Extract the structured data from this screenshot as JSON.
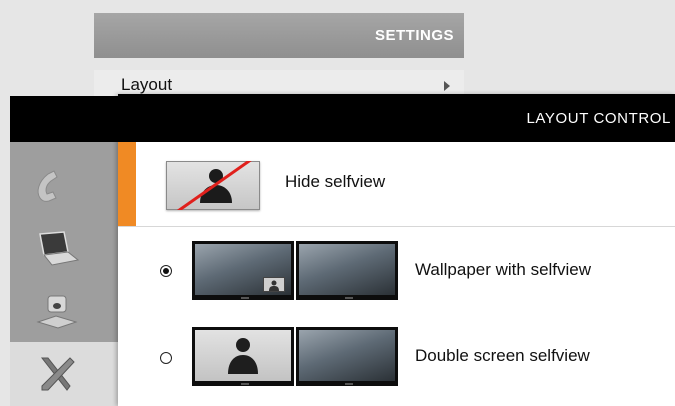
{
  "settings": {
    "title": "SETTINGS",
    "layout_item_label": "Layout"
  },
  "sidebar": {
    "items": [
      {
        "icon": "phone-icon"
      },
      {
        "icon": "laptop-icon"
      },
      {
        "icon": "camera-icon"
      },
      {
        "icon": "tools-icon",
        "active": true
      }
    ]
  },
  "dialog": {
    "title": "LAYOUT CONTROL",
    "options": [
      {
        "label": "Hide selfview",
        "selected": false,
        "highlighted": true
      },
      {
        "label": "Wallpaper with selfview",
        "selected": true
      },
      {
        "label": "Double screen selfview",
        "selected": false
      }
    ]
  },
  "colors": {
    "accent": "#f08a24",
    "header_bg": "#000000",
    "sidebar_bg": "#9e9e9e",
    "slash": "#e0201c"
  }
}
